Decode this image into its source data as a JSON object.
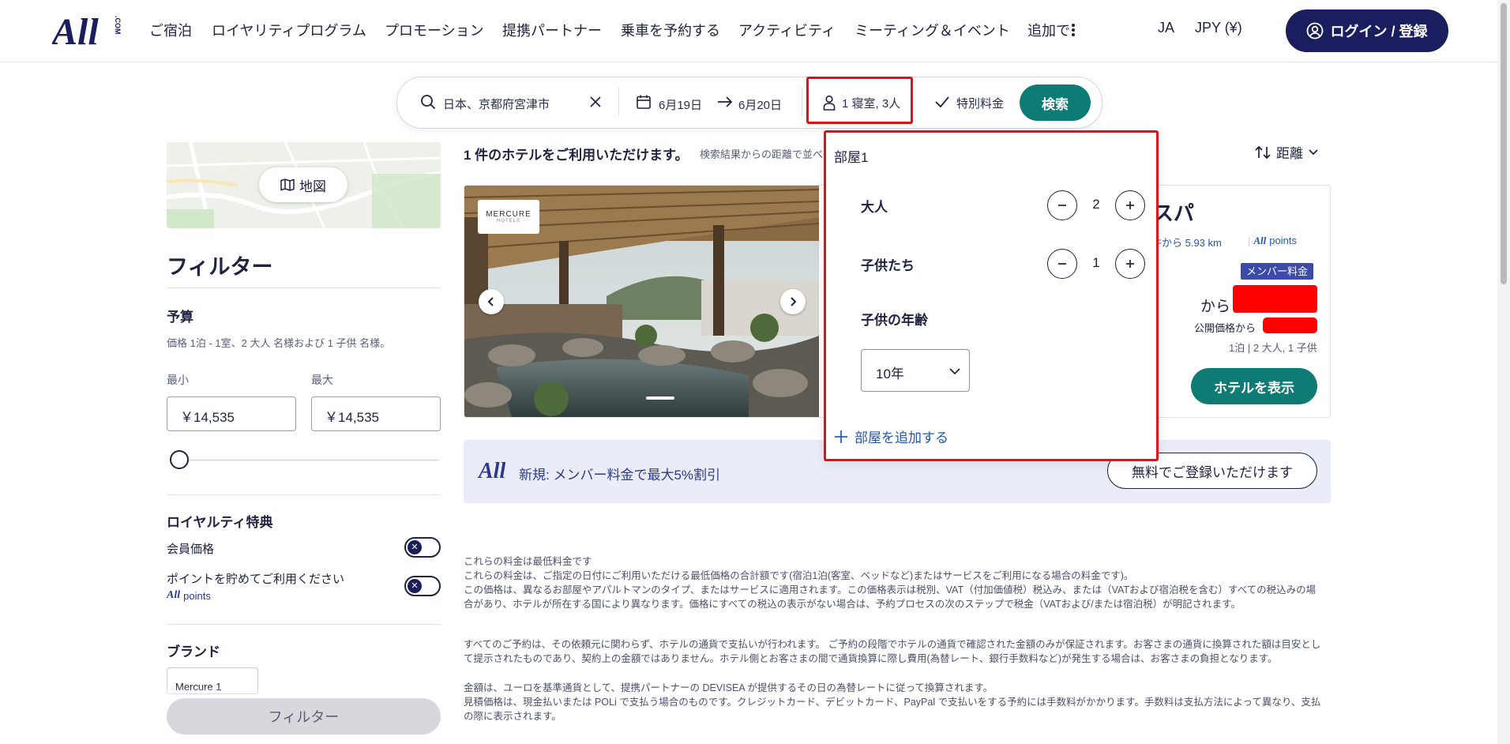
{
  "header": {
    "logo_text": "ALL.COM",
    "nav": [
      "ご宿泊",
      "ロイヤリティプログラム",
      "プロモーション",
      "提携パートナー",
      "乗車を予約する",
      "アクティビティ",
      "ミーティング＆イベント",
      "追加で"
    ],
    "language": "JA",
    "currency": "JPY (¥)",
    "login_label": "ログイン / 登録"
  },
  "search": {
    "destination": "日本、京都府宮津市",
    "checkin": "6月19日",
    "checkout": "6月20日",
    "occupancy": "1 寝室, 3人",
    "special_rate": "特別料金",
    "search_label": "検索"
  },
  "occupancy_popover": {
    "room_title": "部屋1",
    "adults_label": "大人",
    "adults": "2",
    "children_label": "子供たち",
    "children": "1",
    "child_age_label": "子供の年齢",
    "child_age": "10年",
    "add_room": "部屋を追加する"
  },
  "sidebar": {
    "map_label": "地図",
    "filter_title": "フィルター",
    "budget_title": "予算",
    "budget_note": "価格 1泊 - 1室、2 大人 名様および 1 子供 名様。",
    "min_label": "最小",
    "max_label": "最大",
    "min_value": "￥14,535",
    "max_value": "￥14,535",
    "loyalty_title": "ロイヤルティ特典",
    "member_price": "会員価格",
    "earn_points": "ポイントを貯めてご利用ください",
    "points_label": "points",
    "brand_title": "ブランド",
    "brand_chip": "Mercure 1",
    "filter_button": "フィルター"
  },
  "results": {
    "count_text": "1 件のホテルをご利用いただけます。",
    "sort_note": "検索結果からの距離で並べ",
    "sort_label": "距離",
    "hotel": {
      "brand": "MERCURE",
      "brand_sub": "HOTELS",
      "name_tail": "スパ",
      "distance": "件から 5.93 km",
      "points": "points",
      "member_badge": "メンバー料金",
      "from_label": "から",
      "public_label": "公開価格から",
      "stay_info": "1泊 | 2 大人, 1 子供",
      "view_button": "ホテルを表示"
    },
    "promo": {
      "text": "新規: メンバー料金で最大5%割引",
      "register": "無料でご登録いただけます"
    }
  },
  "disclaimer": {
    "lines": [
      "これらの料金は最低料金です",
      "これらの料金は、ご指定の日付にご利用いただける最低価格の合計額です(宿泊1泊(客室、ベッドなど)またはサービスをご利用になる場合の料金です)。",
      "この価格は、異なるお部屋やアパルトマンのタイプ、またはサービスに適用されます。この価格表示は税別、VAT（付加価値税）税込み、または（VATおよび宿泊税を含む）すべての税込みの場合があり、ホテルが所在する国により異なります。価格にすべての税込の表示がない場合は、予約プロセスの次のステップで税金（VATおよび/または宿泊税）が明記されます。",
      "すべてのご予約は、その依頼元に関わらず、ホテルの通貨で支払いが行われます。 ご予約の段階でホテルの通貨で確認された金額のみが保証されます。お客さまの通貨に換算された額は目安として提示されたものであり、契約上の金額ではありません。ホテル側とお客さまの間で通貨換算に際し費用(為替レート、銀行手数料など)が発生する場合は、お客さまの負担となります。",
      "金額は、ユーロを基準通貨として、提携パートナーの DEVISEA が提供するその日の為替レートに従って換算されます。",
      "見積価格は、現金払いまたは POLi で支払う場合のものです。クレジットカード、デビットカード、PayPal で支払いをする予約には手数料がかかります。手数料は支払方法によって異なり、支払の際に表示されます。"
    ]
  },
  "colors": {
    "brand_navy": "#1b1e5e",
    "teal": "#0e7c75",
    "highlight_red": "#e0101b",
    "redaction": "#ff0000"
  }
}
